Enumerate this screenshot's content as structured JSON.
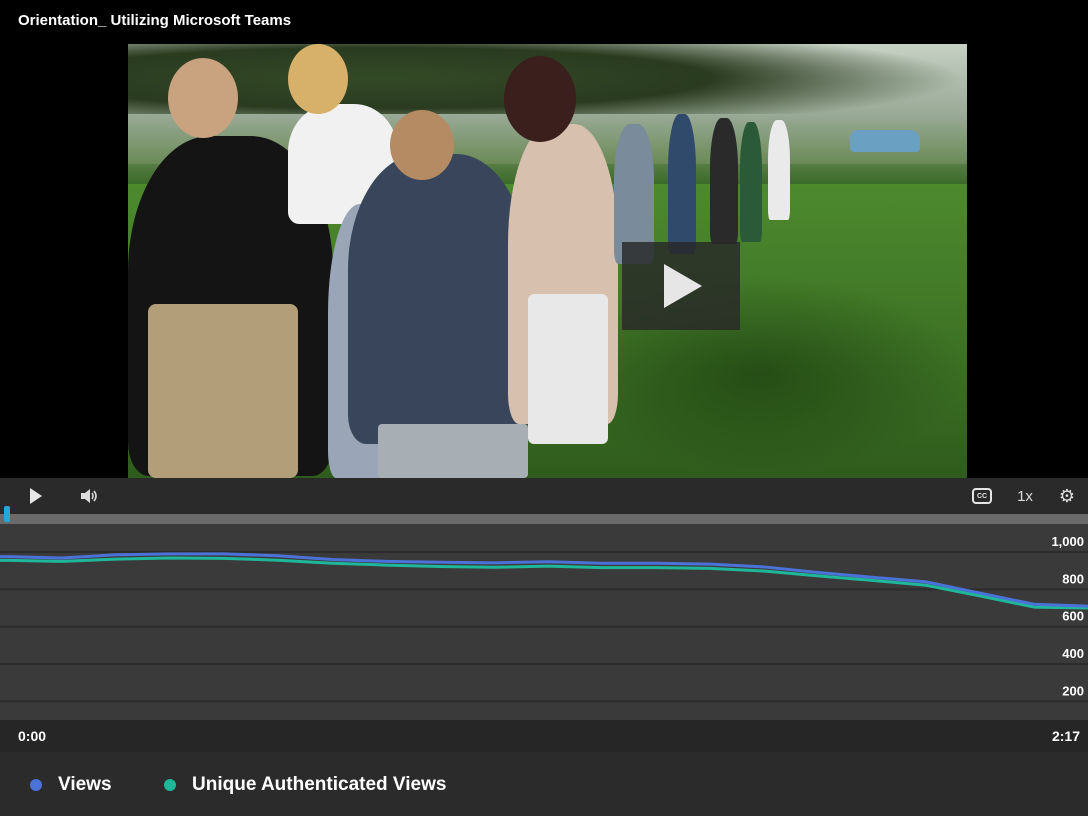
{
  "video": {
    "title": "Orientation_ Utilizing Microsoft Teams"
  },
  "controls": {
    "play_icon": "play-icon",
    "volume_icon": "volume-icon",
    "cc_label": "CC",
    "speed_label": "1x",
    "settings_icon": "gear-icon",
    "progress_fraction": 0.0
  },
  "colors": {
    "views": "#4a72d8",
    "unique": "#1fb79a",
    "accent": "#21a8d9"
  },
  "chart_data": {
    "type": "line",
    "x": [
      "0:00",
      "0:07",
      "0:14",
      "0:21",
      "0:28",
      "0:35",
      "0:42",
      "0:49",
      "0:56",
      "1:03",
      "1:10",
      "1:17",
      "1:24",
      "1:31",
      "1:38",
      "1:45",
      "1:52",
      "1:59",
      "2:06",
      "2:13",
      "2:17"
    ],
    "series": [
      {
        "name": "Views",
        "values": [
          975,
          968,
          985,
          990,
          990,
          980,
          960,
          950,
          945,
          942,
          948,
          940,
          940,
          935,
          920,
          890,
          865,
          840,
          780,
          720,
          710
        ]
      },
      {
        "name": "Unique Authenticated Views",
        "values": [
          955,
          950,
          962,
          968,
          966,
          956,
          940,
          930,
          922,
          918,
          924,
          916,
          916,
          912,
          898,
          872,
          848,
          822,
          765,
          705,
          700
        ]
      }
    ],
    "xlabels": {
      "start": "0:00",
      "end": "2:17"
    },
    "yticks": [
      "1,000",
      "800",
      "600",
      "400",
      "200"
    ],
    "ytick_values": [
      1000,
      800,
      600,
      400,
      200
    ],
    "ylim": [
      100,
      1150
    ],
    "grid": true,
    "legend_position": "bottom"
  }
}
